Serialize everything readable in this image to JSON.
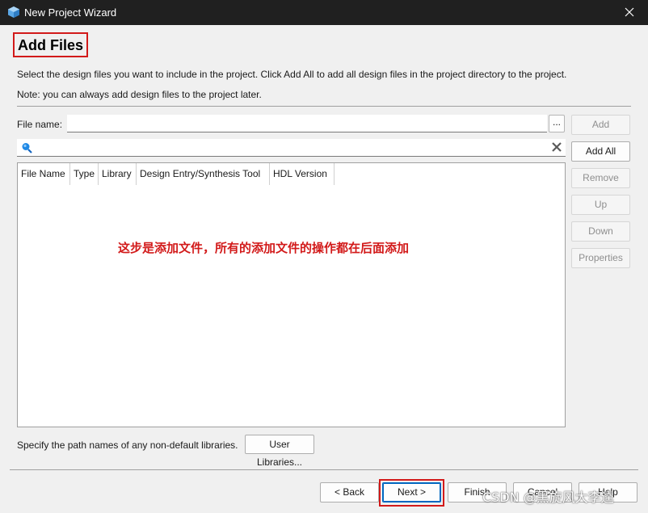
{
  "window": {
    "title": "New Project Wizard"
  },
  "header": {
    "title": "Add Files"
  },
  "description": {
    "line1": "Select the design files you want to include in the project. Click Add All to add all design files in the project directory to the project.",
    "line2": "Note: you can always add design files to the project later."
  },
  "file_name": {
    "label": "File name:",
    "value": "",
    "browse_label": "..."
  },
  "search": {
    "value": ""
  },
  "table": {
    "columns": [
      "File Name",
      "Type",
      "Library",
      "Design Entry/Synthesis Tool",
      "HDL Version"
    ]
  },
  "side_buttons": {
    "add": "Add",
    "add_all": "Add All",
    "remove": "Remove",
    "up": "Up",
    "down": "Down",
    "properties": "Properties"
  },
  "annotation": "这步是添加文件，所有的添加文件的操作都在后面添加",
  "libraries": {
    "label": "Specify the path names of any non-default libraries.",
    "button": "User Libraries..."
  },
  "nav": {
    "back": "< Back",
    "next": "Next >",
    "finish": "Finish",
    "cancel": "Cancel",
    "help": "Help"
  },
  "watermark": "CSDN @黑旋风大李逵",
  "colors": {
    "highlight": "#d21a1a",
    "titlebar": "#202020",
    "focus": "#0067c0"
  }
}
